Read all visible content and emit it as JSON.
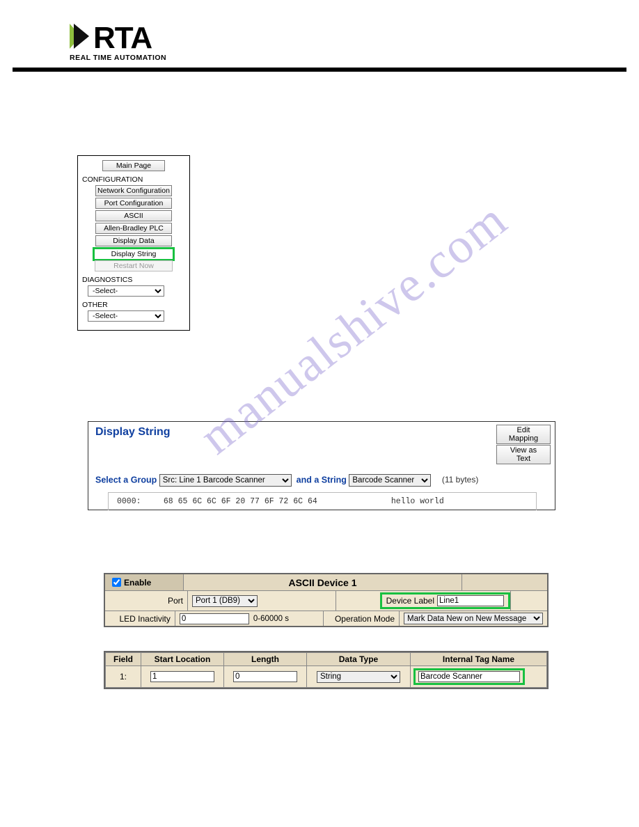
{
  "watermark": "manualshive.com",
  "logo": {
    "main": "RTA",
    "sub": "REAL TIME AUTOMATION"
  },
  "sidebar": {
    "main_page": "Main Page",
    "section_config": "CONFIGURATION",
    "buttons": {
      "network": "Network Configuration",
      "port": "Port Configuration",
      "ascii": "ASCII",
      "ab": "Allen-Bradley PLC",
      "disp_data": "Display Data",
      "disp_string": "Display String",
      "restart": "Restart Now"
    },
    "section_diag": "DIAGNOSTICS",
    "diag_select": "-Select-",
    "section_other": "OTHER",
    "other_select": "-Select-"
  },
  "display_string": {
    "title": "Display String",
    "edit_mapping": "Edit Mapping",
    "view_as_text": "View as Text",
    "select_group_label": "Select a Group",
    "group_value": "Src: Line 1 Barcode Scanner",
    "and_string_label": "and a String",
    "string_value": "Barcode Scanner",
    "bytes": "(11 bytes)",
    "hex_addr": "0000:",
    "hex_bytes": "68 65 6C 6C 6F 20 77 6F 72 6C 64",
    "hex_ascii": "hello world"
  },
  "ascii_device": {
    "enable_label": "Enable",
    "title": "ASCII Device 1",
    "port_label": "Port",
    "port_value": "Port 1 (DB9)",
    "device_label_label": "Device Label",
    "device_label_value": "Line1",
    "led_label": "LED Inactivity",
    "led_value": "0",
    "led_range": "0-60000 s",
    "op_label": "Operation Mode",
    "op_value": "Mark Data New on New Message"
  },
  "field_table": {
    "headers": {
      "field": "Field",
      "start": "Start Location",
      "length": "Length",
      "dtype": "Data Type",
      "tag": "Internal Tag Name"
    },
    "row": {
      "num": "1:",
      "start": "1",
      "length": "0",
      "dtype": "String",
      "tag": "Barcode Scanner"
    }
  }
}
